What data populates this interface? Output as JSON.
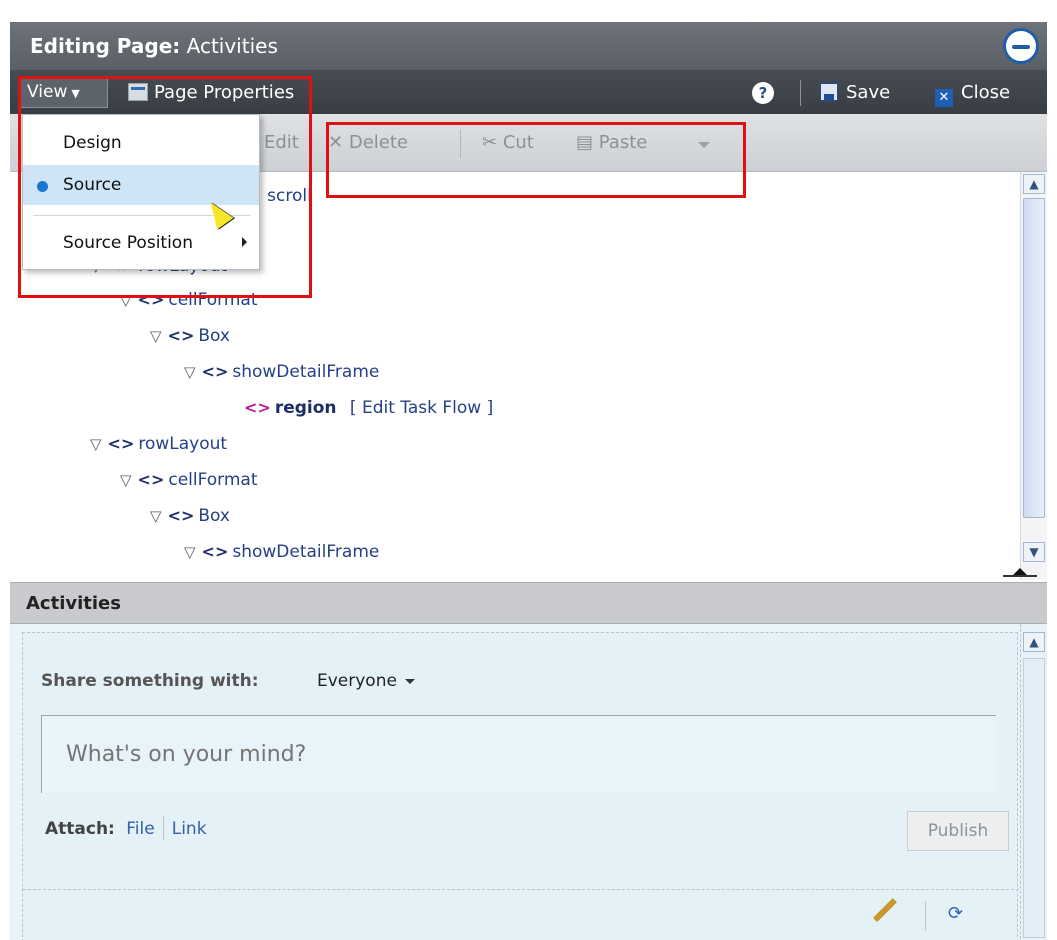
{
  "window": {
    "title_prefix": "Editing Page:",
    "title_page": "Activities"
  },
  "toolbar": {
    "view_label": "View",
    "page_properties_label": "Page Properties",
    "help_label": "?",
    "save_label": "Save",
    "close_label": "Close"
  },
  "toolbar2": {
    "edit_label": "Edit",
    "delete_label": "Delete",
    "cut_label": "Cut",
    "paste_label": "Paste"
  },
  "view_menu": {
    "items": [
      {
        "label": "Design",
        "selected": false
      },
      {
        "label": "Source",
        "selected": true
      },
      {
        "label": "Source Position",
        "has_submenu": true
      }
    ]
  },
  "source_tree": {
    "fragment": ": scroll",
    "nodes": [
      {
        "label": "rowLayout",
        "expanded": true,
        "icon": "tag-icon"
      },
      {
        "label": "cellFormat",
        "expanded": true,
        "icon": "tag-icon"
      },
      {
        "label": "Box",
        "expanded": true,
        "icon": "tag-icon"
      },
      {
        "label": "showDetailFrame",
        "expanded": true,
        "icon": "tag-icon"
      },
      {
        "label": "region",
        "action_open": "[",
        "action": "Edit Task Flow",
        "action_close": "]",
        "icon": "region-tag-icon"
      },
      {
        "label": "rowLayout",
        "expanded": true,
        "icon": "tag-icon"
      },
      {
        "label": "cellFormat",
        "expanded": true,
        "icon": "tag-icon"
      },
      {
        "label": "Box",
        "expanded": true,
        "icon": "tag-icon"
      },
      {
        "label": "showDetailFrame",
        "expanded": true,
        "icon": "tag-icon"
      }
    ]
  },
  "activities": {
    "header": "Activities",
    "share_label": "Share something with:",
    "share_value": "Everyone",
    "input_placeholder": "What's on your mind?",
    "attach_label": "Attach:",
    "file_link": "File",
    "link_link": "Link",
    "publish_label": "Publish"
  },
  "colors": {
    "highlight_box": "#e01010",
    "menu_selected_bg": "#cde5f7",
    "accent_blue": "#1a76d2"
  }
}
